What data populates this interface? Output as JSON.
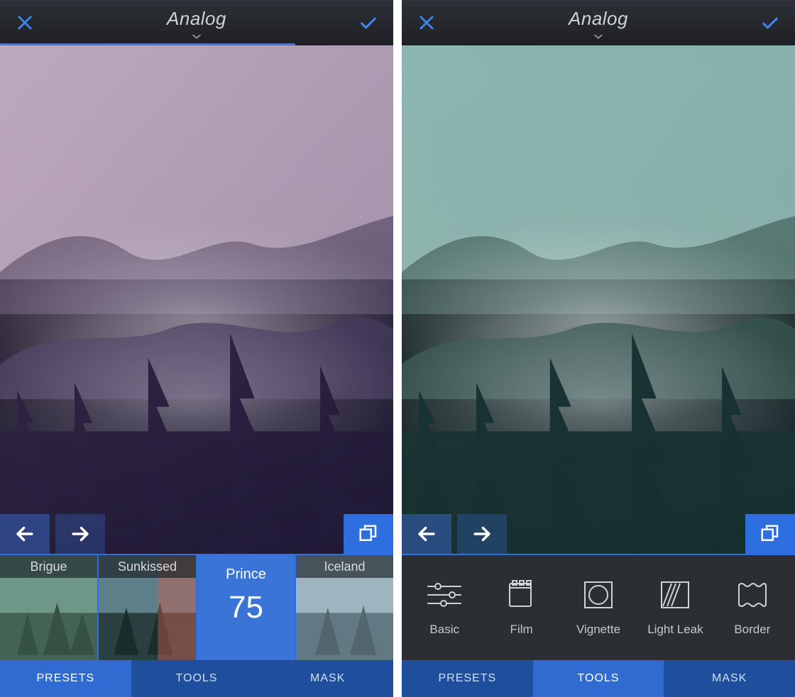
{
  "left": {
    "header": {
      "title": "Analog"
    },
    "slider": {
      "percent": 75
    },
    "presets": [
      {
        "name": "Brigue",
        "selected": false
      },
      {
        "name": "Sunkissed",
        "selected": false
      },
      {
        "name": "Prince",
        "selected": true,
        "value": 75
      },
      {
        "name": "Iceland",
        "selected": false
      }
    ],
    "tabs": {
      "presets": "PRESETS",
      "tools": "TOOLS",
      "mask": "MASK",
      "active": "presets"
    }
  },
  "right": {
    "header": {
      "title": "Analog"
    },
    "tools": [
      {
        "name": "Basic",
        "icon": "sliders-icon"
      },
      {
        "name": "Film",
        "icon": "film-icon"
      },
      {
        "name": "Vignette",
        "icon": "vignette-icon"
      },
      {
        "name": "Light Leak",
        "icon": "light-leak-icon"
      },
      {
        "name": "Border",
        "icon": "border-icon"
      }
    ],
    "tabs": {
      "presets": "PRESETS",
      "tools": "TOOLS",
      "mask": "MASK",
      "active": "tools"
    }
  },
  "colors": {
    "accent": "#2f6fe0",
    "header_bg": "#24272c",
    "panel_bg": "#2b2f34"
  }
}
